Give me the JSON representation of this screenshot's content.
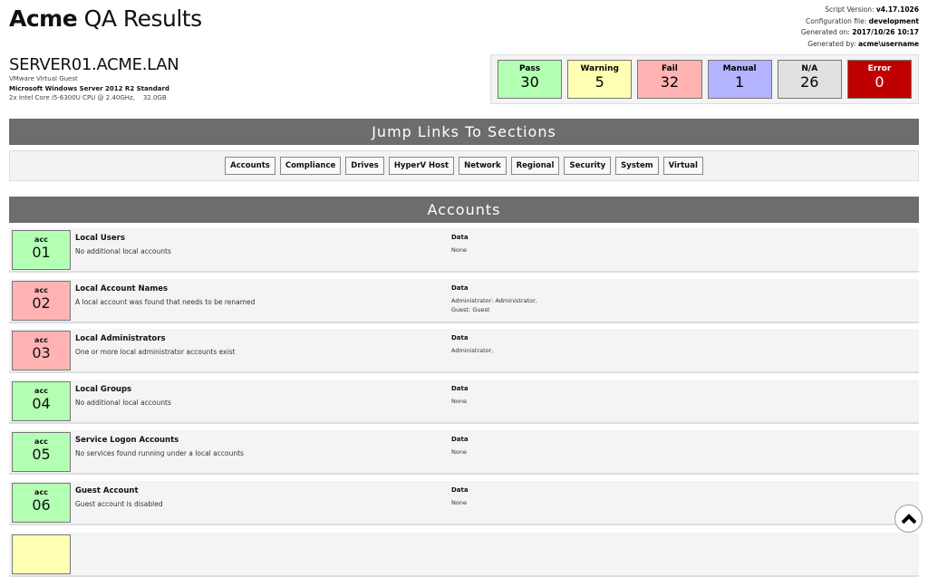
{
  "header": {
    "title_bold": "Acme",
    "title_rest": "QA Results"
  },
  "meta": [
    {
      "label": "Script Version:",
      "value": "v4.17.1026"
    },
    {
      "label": "Configuration file:",
      "value": "development"
    },
    {
      "label": "Generated on:",
      "value": "2017/10/26 10:17"
    },
    {
      "label": "Generated by:",
      "value": "acme\\username"
    }
  ],
  "server": {
    "name": "SERVER01.ACME.LAN",
    "type": "VMware Virtual Guest",
    "os": "Microsoft Windows Server 2012 R2 Standard",
    "hw": "2x Intel Core i5-6300U CPU @ 2.40GHz,    32.0GB"
  },
  "summary": [
    {
      "label": "Pass",
      "value": "30",
      "bg": "#b3ffb3",
      "fg": "#000"
    },
    {
      "label": "Warning",
      "value": "5",
      "bg": "#ffffb3",
      "fg": "#000"
    },
    {
      "label": "Fail",
      "value": "32",
      "bg": "#ffb3b3",
      "fg": "#000"
    },
    {
      "label": "Manual",
      "value": "1",
      "bg": "#b3b3ff",
      "fg": "#000"
    },
    {
      "label": "N/A",
      "value": "26",
      "bg": "#e0e0e0",
      "fg": "#000"
    },
    {
      "label": "Error",
      "value": "0",
      "bg": "#c00000",
      "fg": "#fff"
    }
  ],
  "jump": {
    "title": "Jump Links To Sections",
    "links": [
      "Accounts",
      "Compliance",
      "Drives",
      "HyperV Host",
      "Network",
      "Regional",
      "Security",
      "System",
      "Virtual"
    ]
  },
  "section": {
    "title": "Accounts"
  },
  "data_label": "Data",
  "rows": [
    {
      "code": "acc",
      "num": "01",
      "status": "pass",
      "title": "Local Users",
      "desc": "No additional local accounts",
      "data": "None"
    },
    {
      "code": "acc",
      "num": "02",
      "status": "fail",
      "title": "Local Account Names",
      "desc": "A local account was found that needs to be renamed",
      "data": "Administrator: Administrator,\nGuest: Guest"
    },
    {
      "code": "acc",
      "num": "03",
      "status": "fail",
      "title": "Local Administrators",
      "desc": "One or more local administrator accounts exist",
      "data": "Administrator,"
    },
    {
      "code": "acc",
      "num": "04",
      "status": "pass",
      "title": "Local Groups",
      "desc": "No additional local accounts",
      "data": "None"
    },
    {
      "code": "acc",
      "num": "05",
      "status": "pass",
      "title": "Service Logon Accounts",
      "desc": "No services found running under a local accounts",
      "data": "None"
    },
    {
      "code": "acc",
      "num": "06",
      "status": "pass",
      "title": "Guest Account",
      "desc": "Guest account is disabled",
      "data": "None"
    }
  ],
  "colors": {
    "pass": "#b3ffb3",
    "fail": "#ffb3b3",
    "warning": "#ffffb3"
  }
}
